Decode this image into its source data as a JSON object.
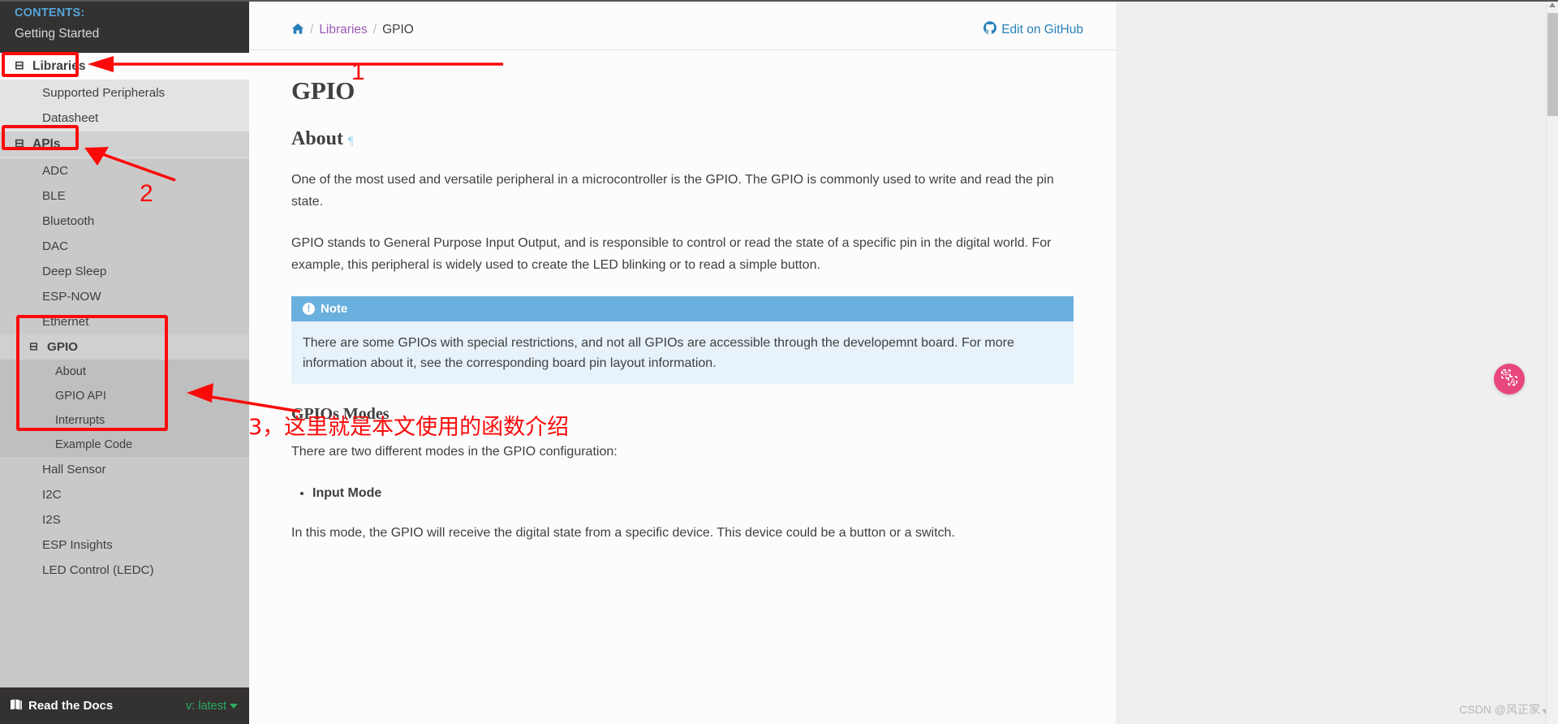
{
  "sidebar": {
    "contents_caption": "CONTENTS:",
    "top_item": "Getting Started",
    "libraries": {
      "label": "Libraries",
      "toggle": "⊟"
    },
    "libraries_children": [
      "Supported Peripherals",
      "Datasheet"
    ],
    "apis": {
      "label": "APIs",
      "toggle": "⊟"
    },
    "apis_children_before": [
      "ADC",
      "BLE",
      "Bluetooth",
      "DAC",
      "Deep Sleep",
      "ESP-NOW",
      "Ethernet"
    ],
    "gpio": {
      "label": "GPIO",
      "toggle": "⊟"
    },
    "gpio_children": [
      "About",
      "GPIO API",
      "Interrupts",
      "Example Code"
    ],
    "apis_children_after": [
      "Hall Sensor",
      "I2C",
      "I2S",
      "ESP Insights",
      "LED Control (LEDC)"
    ],
    "footer": {
      "brand": "Read the Docs",
      "brand_icon": "book-icon",
      "version": "v: latest"
    }
  },
  "header": {
    "breadcrumb": {
      "home_icon": "home-icon",
      "sep": "/",
      "link": "Libraries",
      "current": "GPIO"
    },
    "edit_on_github": "Edit on GitHub",
    "github_icon": "github-icon"
  },
  "main": {
    "title": "GPIO",
    "about_heading": "About",
    "headerlink": "¶",
    "p1": "One of the most used and versatile peripheral in a microcontroller is the GPIO. The GPIO is commonly used to write and read the pin state.",
    "p2": "GPIO stands to General Purpose Input Output, and is responsible to control or read the state of a specific pin in the digital world. For example, this peripheral is widely used to create the LED blinking or to read a simple button.",
    "note": {
      "title": "Note",
      "icon": "exclamation-circle-icon",
      "body": "There are some GPIOs with special restrictions, and not all GPIOs are accessible through the developemnt board. For more information about it, see the corresponding board pin layout information."
    },
    "modes_heading": "GPIOs Modes",
    "p3": "There are two different modes in the GPIO configuration:",
    "bullets": [
      "Input Mode"
    ],
    "p4": "In this mode, the GPIO will receive the digital state from a specific device. This device could be a button or a switch."
  },
  "annotations": {
    "num1": "1",
    "num2": "2",
    "num3_text": "3，这里就是本文使用的函数介绍",
    "color": "#fb0a0a"
  },
  "overlay": {
    "translate_button_icon": "translate-icon",
    "watermark": "CSDN @风正家"
  }
}
